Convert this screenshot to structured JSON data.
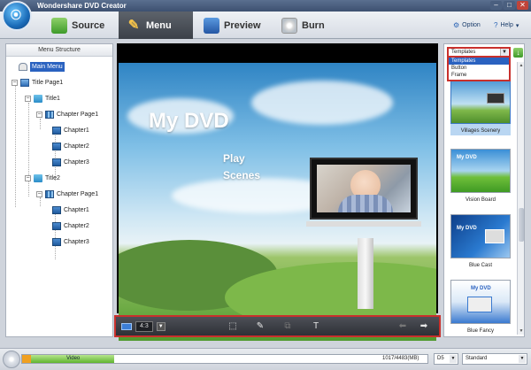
{
  "window": {
    "title": "Wondershare DVD Creator",
    "controls": [
      "–",
      "□",
      "✕"
    ]
  },
  "tabs": [
    {
      "label": "Source",
      "icon": "source-icon"
    },
    {
      "label": "Menu",
      "icon": "menu-icon",
      "active": true
    },
    {
      "label": "Preview",
      "icon": "preview-icon"
    },
    {
      "label": "Burn",
      "icon": "burn-icon"
    }
  ],
  "header_links": {
    "option": "Option",
    "help": "Help"
  },
  "menu_structure": {
    "title": "Menu Structure",
    "main_menu": "Main Menu",
    "title_page": "Title Page1",
    "titles": [
      {
        "label": "Title1",
        "chapter_page": "Chapter Page1",
        "chapters": [
          "Chapter1",
          "Chapter2",
          "Chapter3"
        ]
      },
      {
        "label": "Title2",
        "chapter_page": "Chapter Page1",
        "chapters": [
          "Chapter1",
          "Chapter2",
          "Chapter3"
        ]
      }
    ]
  },
  "preview": {
    "dvd_title": "My DVD",
    "buttons": [
      "Play",
      "Scenes"
    ],
    "aspect_ratio": "4:3"
  },
  "templates": {
    "dropdown_value": "Templates",
    "options": [
      "Templates",
      "Button",
      "Frame"
    ],
    "selected_option": "Templates",
    "items": [
      {
        "name": "Villages Scenery",
        "selected": true,
        "thumb_text": ""
      },
      {
        "name": "Vision Board",
        "thumb_text": "My DVD"
      },
      {
        "name": "Blue Cast",
        "thumb_text": "My DVD"
      },
      {
        "name": "Blue Fancy",
        "thumb_text": "My DVD"
      }
    ]
  },
  "status": {
    "capacity_label": "Video",
    "capacity_text": "1017/4483(MB)",
    "capacity_fraction": 0.227,
    "disc_type": "D5",
    "quality": "Standard"
  },
  "colors": {
    "accent_red": "#c9302c",
    "selection_blue": "#2a62c0",
    "capacity_green": "#5fb52f"
  }
}
